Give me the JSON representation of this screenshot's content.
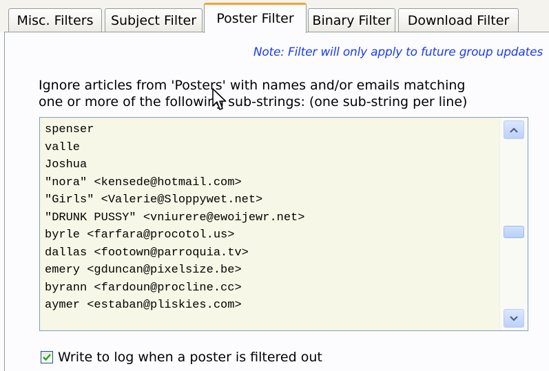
{
  "tabs": {
    "misc": "Misc. Filters",
    "subject": "Subject Filter",
    "poster": "Poster Filter",
    "binary": "Binary Filter",
    "download": "Download Filter"
  },
  "active_tab": "Poster Filter",
  "note": "Note: Filter will only apply to future group updates",
  "description": {
    "line1": "Ignore articles from 'Posters' with names and/or emails matching",
    "line2": "one or more of the following sub-strings: (one sub-string per line)"
  },
  "poster_list": [
    "spenser",
    "valle",
    "Joshua",
    "\"nora\" <kensede@hotmail.com>",
    "\"Girls\" <Valerie@Sloppywet.net>",
    "\"DRUNK PUSSY\" <vniurere@ewoijewr.net>",
    "byrle <farfara@procotol.us>",
    "dallas <footown@parroquia.tv>",
    "emery <gduncan@pixelsize.be>",
    "byrann <fardoun@procline.cc>",
    "aymer <estaban@pliskies.com>"
  ],
  "scroll_position": 0.55,
  "log_checkbox": {
    "label": "Write to log when a poster is filtered out",
    "checked": true
  },
  "colors": {
    "note": "#1a3cf0",
    "active_tab_accent": "#f7a12f",
    "list_background": "#f6f7e6",
    "scrollbar_accent": "#bcd1fa"
  },
  "icons": {
    "scroll_up": "chevron-up-icon",
    "scroll_down": "chevron-down-icon",
    "checkmark": "checkmark-icon",
    "mouse_cursor": "arrow-cursor-icon"
  }
}
